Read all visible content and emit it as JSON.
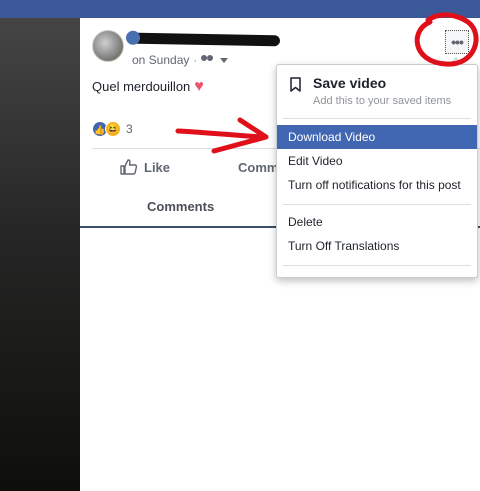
{
  "post": {
    "time": "on Sunday",
    "dot": "·",
    "text": "Quel merdouillon",
    "heart": "♥",
    "reaction_count": "3",
    "like_label": "Like",
    "comment_label": "Comment",
    "comments_tab": "Comments",
    "more_glyph": "•••"
  },
  "menu": {
    "save_title": "Save video",
    "save_subtitle": "Add this to your saved items",
    "items": [
      "Download Video",
      "Edit Video",
      "Turn off notifications for this post",
      "Delete",
      "Turn Off Translations"
    ]
  },
  "colors": {
    "brand": "#3b5998",
    "highlight": "#4267b2",
    "annotation": "#e0101a"
  },
  "icons": [
    "bookmark-icon",
    "like-icon",
    "comment-icon",
    "friends-icon",
    "more-icon",
    "heart-icon",
    "haha-icon"
  ]
}
